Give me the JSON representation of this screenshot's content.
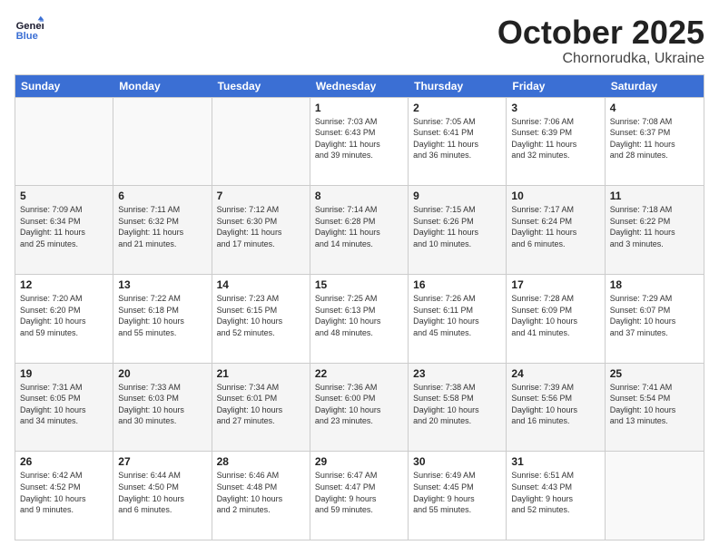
{
  "header": {
    "logo_line1": "General",
    "logo_line2": "Blue",
    "month": "October 2025",
    "location": "Chornorudka, Ukraine"
  },
  "day_headers": [
    "Sunday",
    "Monday",
    "Tuesday",
    "Wednesday",
    "Thursday",
    "Friday",
    "Saturday"
  ],
  "rows": [
    {
      "shade": false,
      "cells": [
        {
          "date": "",
          "info": ""
        },
        {
          "date": "",
          "info": ""
        },
        {
          "date": "",
          "info": ""
        },
        {
          "date": "1",
          "info": "Sunrise: 7:03 AM\nSunset: 6:43 PM\nDaylight: 11 hours\nand 39 minutes."
        },
        {
          "date": "2",
          "info": "Sunrise: 7:05 AM\nSunset: 6:41 PM\nDaylight: 11 hours\nand 36 minutes."
        },
        {
          "date": "3",
          "info": "Sunrise: 7:06 AM\nSunset: 6:39 PM\nDaylight: 11 hours\nand 32 minutes."
        },
        {
          "date": "4",
          "info": "Sunrise: 7:08 AM\nSunset: 6:37 PM\nDaylight: 11 hours\nand 28 minutes."
        }
      ]
    },
    {
      "shade": true,
      "cells": [
        {
          "date": "5",
          "info": "Sunrise: 7:09 AM\nSunset: 6:34 PM\nDaylight: 11 hours\nand 25 minutes."
        },
        {
          "date": "6",
          "info": "Sunrise: 7:11 AM\nSunset: 6:32 PM\nDaylight: 11 hours\nand 21 minutes."
        },
        {
          "date": "7",
          "info": "Sunrise: 7:12 AM\nSunset: 6:30 PM\nDaylight: 11 hours\nand 17 minutes."
        },
        {
          "date": "8",
          "info": "Sunrise: 7:14 AM\nSunset: 6:28 PM\nDaylight: 11 hours\nand 14 minutes."
        },
        {
          "date": "9",
          "info": "Sunrise: 7:15 AM\nSunset: 6:26 PM\nDaylight: 11 hours\nand 10 minutes."
        },
        {
          "date": "10",
          "info": "Sunrise: 7:17 AM\nSunset: 6:24 PM\nDaylight: 11 hours\nand 6 minutes."
        },
        {
          "date": "11",
          "info": "Sunrise: 7:18 AM\nSunset: 6:22 PM\nDaylight: 11 hours\nand 3 minutes."
        }
      ]
    },
    {
      "shade": false,
      "cells": [
        {
          "date": "12",
          "info": "Sunrise: 7:20 AM\nSunset: 6:20 PM\nDaylight: 10 hours\nand 59 minutes."
        },
        {
          "date": "13",
          "info": "Sunrise: 7:22 AM\nSunset: 6:18 PM\nDaylight: 10 hours\nand 55 minutes."
        },
        {
          "date": "14",
          "info": "Sunrise: 7:23 AM\nSunset: 6:15 PM\nDaylight: 10 hours\nand 52 minutes."
        },
        {
          "date": "15",
          "info": "Sunrise: 7:25 AM\nSunset: 6:13 PM\nDaylight: 10 hours\nand 48 minutes."
        },
        {
          "date": "16",
          "info": "Sunrise: 7:26 AM\nSunset: 6:11 PM\nDaylight: 10 hours\nand 45 minutes."
        },
        {
          "date": "17",
          "info": "Sunrise: 7:28 AM\nSunset: 6:09 PM\nDaylight: 10 hours\nand 41 minutes."
        },
        {
          "date": "18",
          "info": "Sunrise: 7:29 AM\nSunset: 6:07 PM\nDaylight: 10 hours\nand 37 minutes."
        }
      ]
    },
    {
      "shade": true,
      "cells": [
        {
          "date": "19",
          "info": "Sunrise: 7:31 AM\nSunset: 6:05 PM\nDaylight: 10 hours\nand 34 minutes."
        },
        {
          "date": "20",
          "info": "Sunrise: 7:33 AM\nSunset: 6:03 PM\nDaylight: 10 hours\nand 30 minutes."
        },
        {
          "date": "21",
          "info": "Sunrise: 7:34 AM\nSunset: 6:01 PM\nDaylight: 10 hours\nand 27 minutes."
        },
        {
          "date": "22",
          "info": "Sunrise: 7:36 AM\nSunset: 6:00 PM\nDaylight: 10 hours\nand 23 minutes."
        },
        {
          "date": "23",
          "info": "Sunrise: 7:38 AM\nSunset: 5:58 PM\nDaylight: 10 hours\nand 20 minutes."
        },
        {
          "date": "24",
          "info": "Sunrise: 7:39 AM\nSunset: 5:56 PM\nDaylight: 10 hours\nand 16 minutes."
        },
        {
          "date": "25",
          "info": "Sunrise: 7:41 AM\nSunset: 5:54 PM\nDaylight: 10 hours\nand 13 minutes."
        }
      ]
    },
    {
      "shade": false,
      "cells": [
        {
          "date": "26",
          "info": "Sunrise: 6:42 AM\nSunset: 4:52 PM\nDaylight: 10 hours\nand 9 minutes."
        },
        {
          "date": "27",
          "info": "Sunrise: 6:44 AM\nSunset: 4:50 PM\nDaylight: 10 hours\nand 6 minutes."
        },
        {
          "date": "28",
          "info": "Sunrise: 6:46 AM\nSunset: 4:48 PM\nDaylight: 10 hours\nand 2 minutes."
        },
        {
          "date": "29",
          "info": "Sunrise: 6:47 AM\nSunset: 4:47 PM\nDaylight: 9 hours\nand 59 minutes."
        },
        {
          "date": "30",
          "info": "Sunrise: 6:49 AM\nSunset: 4:45 PM\nDaylight: 9 hours\nand 55 minutes."
        },
        {
          "date": "31",
          "info": "Sunrise: 6:51 AM\nSunset: 4:43 PM\nDaylight: 9 hours\nand 52 minutes."
        },
        {
          "date": "",
          "info": ""
        }
      ]
    }
  ]
}
